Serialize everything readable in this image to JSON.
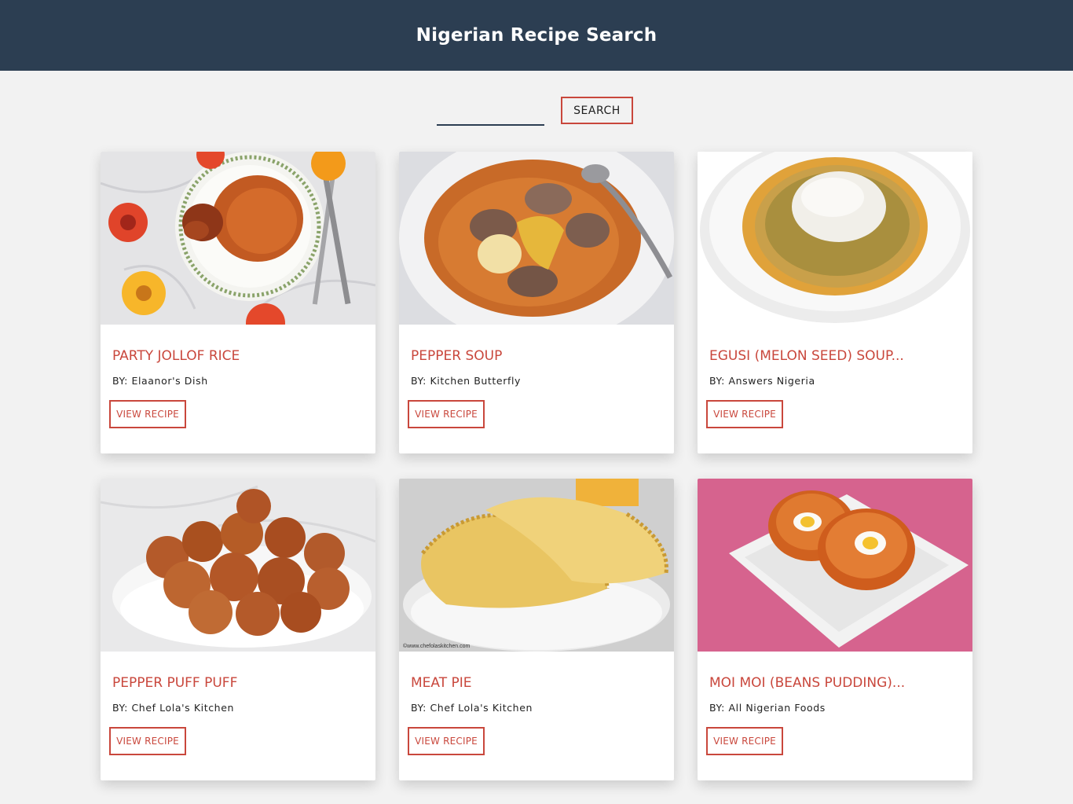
{
  "header": {
    "title": "Nigerian Recipe Search"
  },
  "search": {
    "value": "",
    "placeholder": "",
    "button_label": "SEARCH"
  },
  "by_label": "BY:",
  "view_label": "VIEW RECIPE",
  "recipes": [
    {
      "title": "PARTY JOLLOF RICE",
      "author": "Elaanor's Dish",
      "image": "jollof-rice-photo"
    },
    {
      "title": "PEPPER SOUP",
      "author": "Kitchen Butterfly",
      "image": "pepper-soup-photo"
    },
    {
      "title": "EGUSI (MELON SEED) SOUP...",
      "author": "Answers Nigeria",
      "image": "egusi-soup-photo"
    },
    {
      "title": "PEPPER PUFF PUFF",
      "author": "Chef Lola's Kitchen",
      "image": "puff-puff-photo"
    },
    {
      "title": "MEAT PIE",
      "author": "Chef Lola's Kitchen",
      "image": "meat-pie-photo"
    },
    {
      "title": "MOI MOI (BEANS PUDDING)...",
      "author": "All Nigerian Foods",
      "image": "moi-moi-photo"
    }
  ],
  "colors": {
    "header_bg": "#2c3e52",
    "accent": "#c9473c",
    "page_bg": "#f2f2f2"
  }
}
